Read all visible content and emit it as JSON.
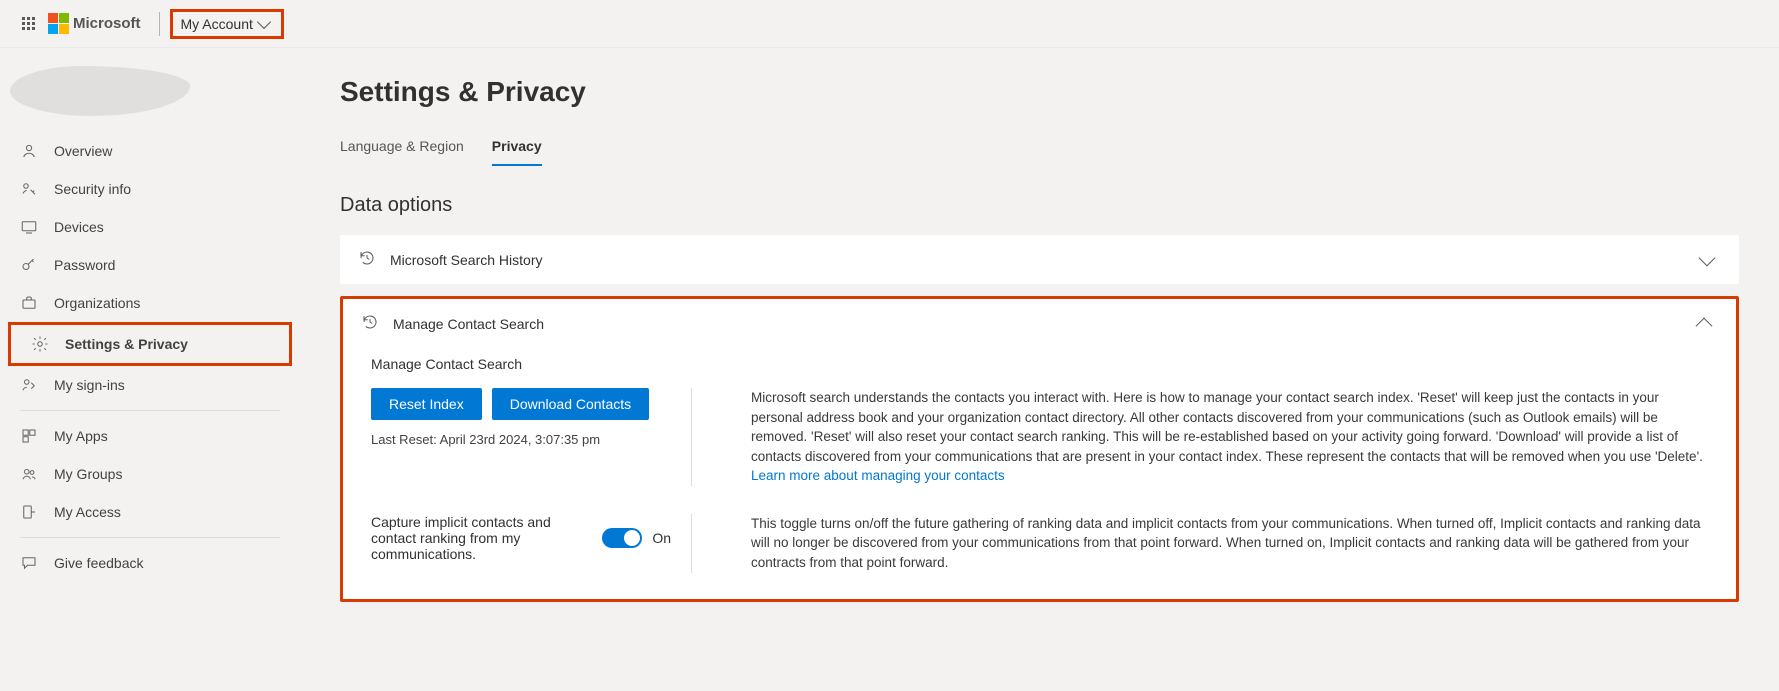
{
  "header": {
    "brand": "Microsoft",
    "account_label": "My Account"
  },
  "sidebar": {
    "items": [
      {
        "label": "Overview"
      },
      {
        "label": "Security info"
      },
      {
        "label": "Devices"
      },
      {
        "label": "Password"
      },
      {
        "label": "Organizations"
      },
      {
        "label": "Settings & Privacy"
      },
      {
        "label": "My sign-ins"
      },
      {
        "label": "My Apps"
      },
      {
        "label": "My Groups"
      },
      {
        "label": "My Access"
      },
      {
        "label": "Give feedback"
      }
    ]
  },
  "page": {
    "title": "Settings & Privacy",
    "tabs": [
      {
        "label": "Language & Region"
      },
      {
        "label": "Privacy"
      }
    ],
    "section_heading": "Data options",
    "panels": {
      "search_history": {
        "title": "Microsoft Search History"
      },
      "contact_search": {
        "title": "Manage Contact Search",
        "subtitle": "Manage Contact Search",
        "reset_btn": "Reset Index",
        "download_btn": "Download Contacts",
        "last_reset": "Last Reset: April 23rd 2024, 3:07:35 pm",
        "description": "Microsoft search understands the contacts you interact with. Here is how to manage your contact search index. 'Reset' will keep just the contacts in your personal address book and your organization contact directory. All other contacts discovered from your communications (such as Outlook emails) will be removed. 'Reset' will also reset your contact search ranking. This will be re-established based on your activity going forward. 'Download' will provide a list of contacts discovered from your communications that are present in your contact index. These represent the contacts that will be removed when you use 'Delete'.",
        "learn_more": "Learn more about managing your contacts",
        "toggle_label": "Capture implicit contacts and contact ranking from my communications.",
        "toggle_state": "On",
        "toggle_description": "This toggle turns on/off the future gathering of ranking data and implicit contacts from your communications. When turned off, Implicit contacts and ranking data will no longer be discovered from your communications from that point forward. When turned on, Implicit contacts and ranking data will be gathered from your contracts from that point forward."
      }
    }
  }
}
